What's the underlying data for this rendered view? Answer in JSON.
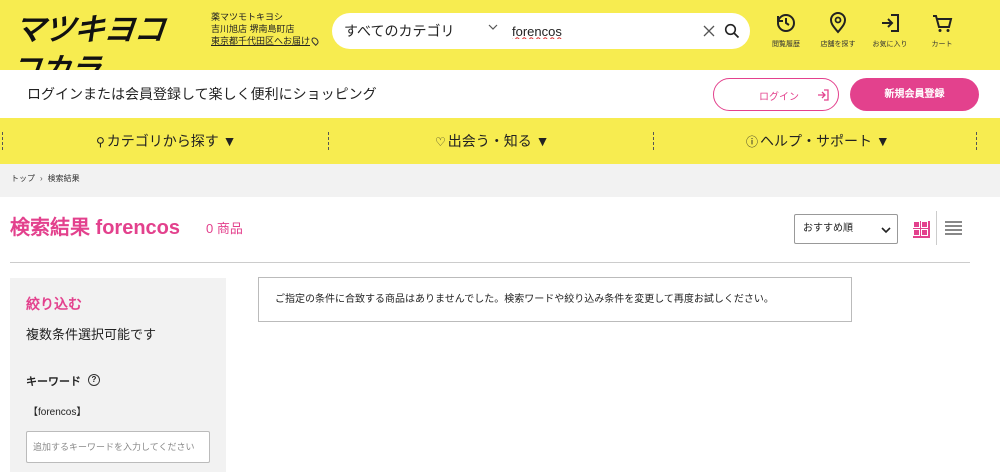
{
  "header": {
    "logo_text": "マツキヨココカラ",
    "store": {
      "line1": "薬マツモトキヨシ",
      "line2": "吉川旭店 堺南島町店",
      "delivery": "東京都千代田区へお届け"
    },
    "search": {
      "category": "すべてのカテゴリ",
      "query": "forencos"
    },
    "icons": [
      {
        "name": "history-icon",
        "label": "閲覧履歴"
      },
      {
        "name": "store-search-icon",
        "label": "店舗を探す"
      },
      {
        "name": "favorites-icon",
        "label": "お気に入り"
      },
      {
        "name": "cart-icon",
        "label": "カート"
      }
    ]
  },
  "login_bar": {
    "message": "ログインまたは会員登録して楽しく便利にショッピング",
    "login_label": "ログイン",
    "register_label": "新規会員登録"
  },
  "nav": {
    "items": [
      {
        "label": "カテゴリから探す ▼"
      },
      {
        "label": "出会う・知る ▼"
      },
      {
        "label": "ヘルプ・サポート ▼"
      }
    ]
  },
  "breadcrumb": {
    "home": "トップ",
    "current": "検索結果"
  },
  "results": {
    "title": "検索結果 forencos",
    "count": "0 商品",
    "sort": "おすすめ順",
    "message": "ご指定の条件に合致する商品はありませんでした。検索ワードや絞り込み条件を変更して再度お試しください。"
  },
  "sidebar": {
    "title": "絞り込む",
    "subtitle": "複数条件選択可能です",
    "keyword_label": "キーワード",
    "keyword_current": "【forencos】",
    "keyword_placeholder": "追加するキーワードを入力してください"
  },
  "colors": {
    "brand_yellow": "#f7ec50",
    "accent_pink": "#e3418d"
  }
}
